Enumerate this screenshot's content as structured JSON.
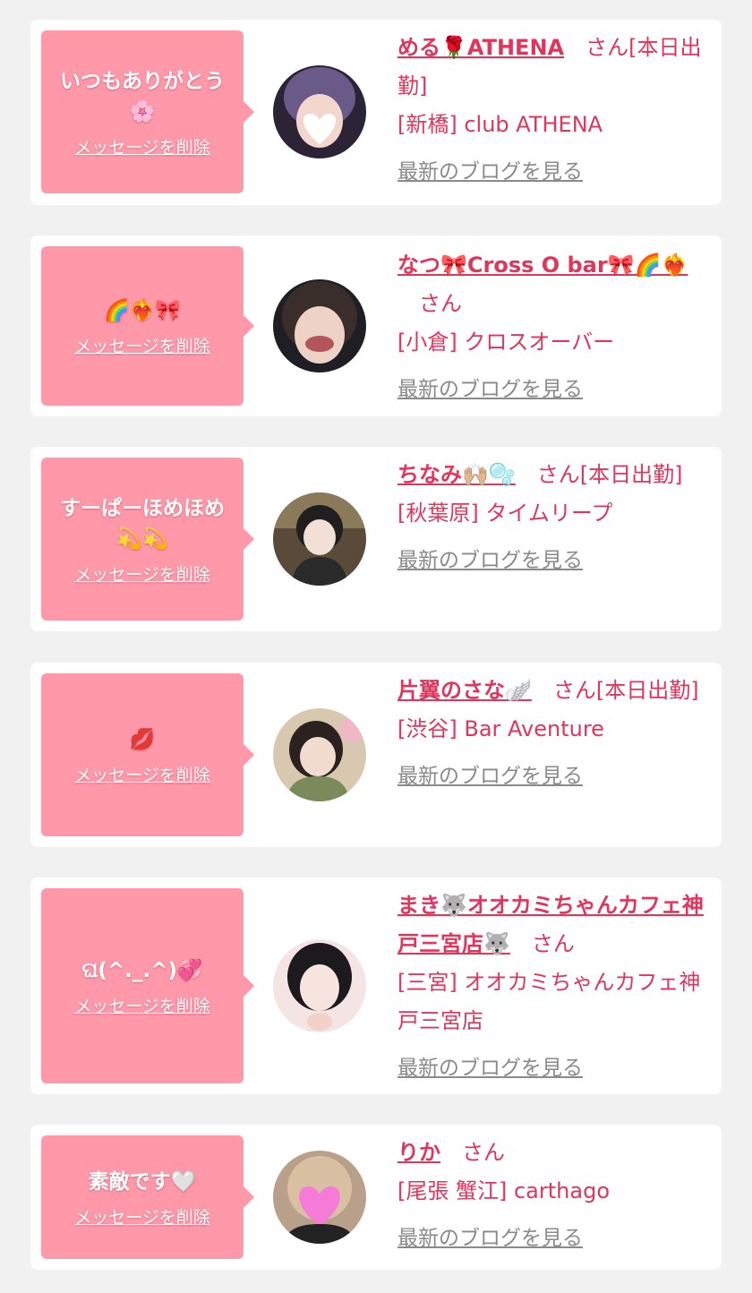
{
  "delete_label": "メッセージを削除",
  "blog_label": "最新のブログを見る",
  "items": [
    {
      "message": "いつもありがとう🌸",
      "name": "める🌹ATHENA",
      "suffix": "さん[本日出勤]",
      "shop": "[新橋] club ATHENA"
    },
    {
      "message": "🌈❤️‍🔥🎀",
      "name": "なつ🎀Cross O bar🎀🌈❤️‍🔥",
      "suffix": "さん",
      "shop": "[小倉] クロスオーバー"
    },
    {
      "message": "すーぱーほめほめ💫💫",
      "name": "ちなみ🙌🏼🫧",
      "suffix": "さん[本日出勤]",
      "shop": "[秋葉原] タイムリープ"
    },
    {
      "message": "💋",
      "name": "片翼のさな🪽",
      "suffix": "さん[本日出勤]",
      "shop": "[渋谷] Bar Aventure"
    },
    {
      "message": "ଘ(^._.^)💞",
      "name": "まき🐺オオカミちゃんカフェ神戸三宮店🐺",
      "suffix": "さん",
      "shop": "[三宮] オオカミちゃんカフェ神戸三宮店"
    },
    {
      "message": "素敵です🤍",
      "name": "りか",
      "suffix": "さん",
      "shop": "[尾張 蟹江] carthago"
    }
  ]
}
